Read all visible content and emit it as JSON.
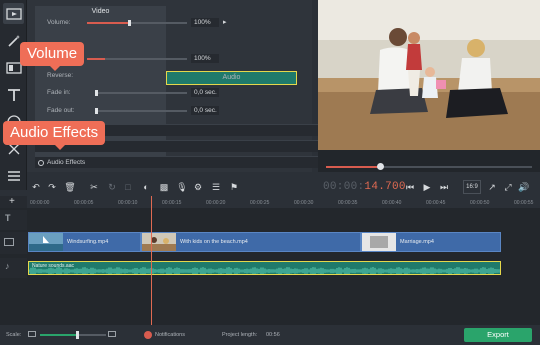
{
  "panel": {
    "tabs": {
      "video": "Video",
      "audio": "Audio"
    },
    "volume_label": "Volume:",
    "volume_value": "100%",
    "volume_fraction": 0.42,
    "second_value": "100%",
    "reverse_label": "Reverse:",
    "fade_in_label": "Fade in:",
    "fade_in_value": "0,0 sec.",
    "fade_out_label": "Fade out:",
    "fade_out_value": "0,0 sec.",
    "audio_effects_label": "Audio Effects"
  },
  "callouts": {
    "volume": "Volume",
    "audio_effects": "Audio Effects"
  },
  "preview": {
    "progress_fraction": 0.26
  },
  "controls": {
    "time_prefix": "00:00:",
    "time_hot": "14.700",
    "aspect_label": "16:9"
  },
  "timeline": {
    "ticks": [
      "00:00:00",
      "00:00:05",
      "00:00:10",
      "00:00:15",
      "00:00:20",
      "00:00:25",
      "00:00:30",
      "00:00:35",
      "00:00:40",
      "00:00:45",
      "00:00:50",
      "00:00:55"
    ],
    "clips": [
      "Windsurfing.mp4",
      "With kids on the beach.mp4",
      "Marriage.mp4"
    ],
    "audio_clip": "Nature sounds.aac"
  },
  "status": {
    "scale_label": "Scale:",
    "notifications_label": "Notifications",
    "project_length_label": "Project length:",
    "project_length_value": "00:56",
    "export_label": "Export"
  },
  "colors": {
    "accent": "#ef6e57",
    "export_green": "#2aa46b",
    "clip_blue": "#3f6aa8",
    "audio_teal": "#1f7a6b"
  }
}
